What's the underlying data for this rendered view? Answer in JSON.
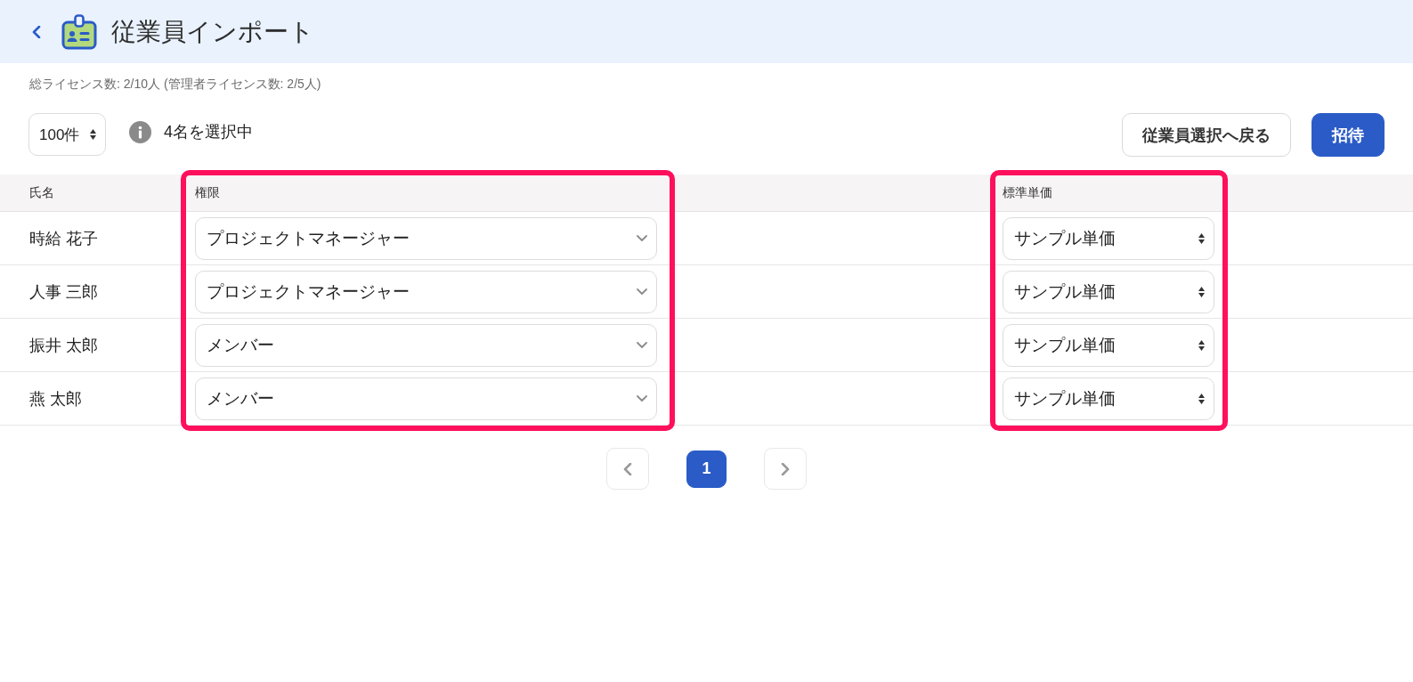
{
  "header": {
    "title": "従業員インポート"
  },
  "license_summary": "総ライセンス数: 2/10人 (管理者ライセンス数: 2/5人)",
  "toolbar": {
    "page_size": "100件",
    "selection_info": "4名を選択中",
    "buttons": [
      {
        "label": "従業員選択へ戻る",
        "kind": "secondary"
      },
      {
        "label": "招待",
        "kind": "primary"
      }
    ]
  },
  "table": {
    "columns": [
      {
        "label": "氏名",
        "kind": "text",
        "highlighted": false
      },
      {
        "label": "権限",
        "kind": "dropdown",
        "highlighted": true
      },
      {
        "label": "標準単価",
        "kind": "picker",
        "highlighted": true
      }
    ],
    "rows": [
      {
        "cells": [
          "時給 花子",
          "プロジェクトマネージャー",
          "サンプル単価"
        ]
      },
      {
        "cells": [
          "人事 三郎",
          "プロジェクトマネージャー",
          "サンプル単価"
        ]
      },
      {
        "cells": [
          "振井 太郎",
          "メンバー",
          "サンプル単価"
        ]
      },
      {
        "cells": [
          "燕 太郎",
          "メンバー",
          "サンプル単価"
        ]
      }
    ]
  },
  "pagination": {
    "pages": [
      {
        "label": "1",
        "selected": true
      }
    ]
  }
}
